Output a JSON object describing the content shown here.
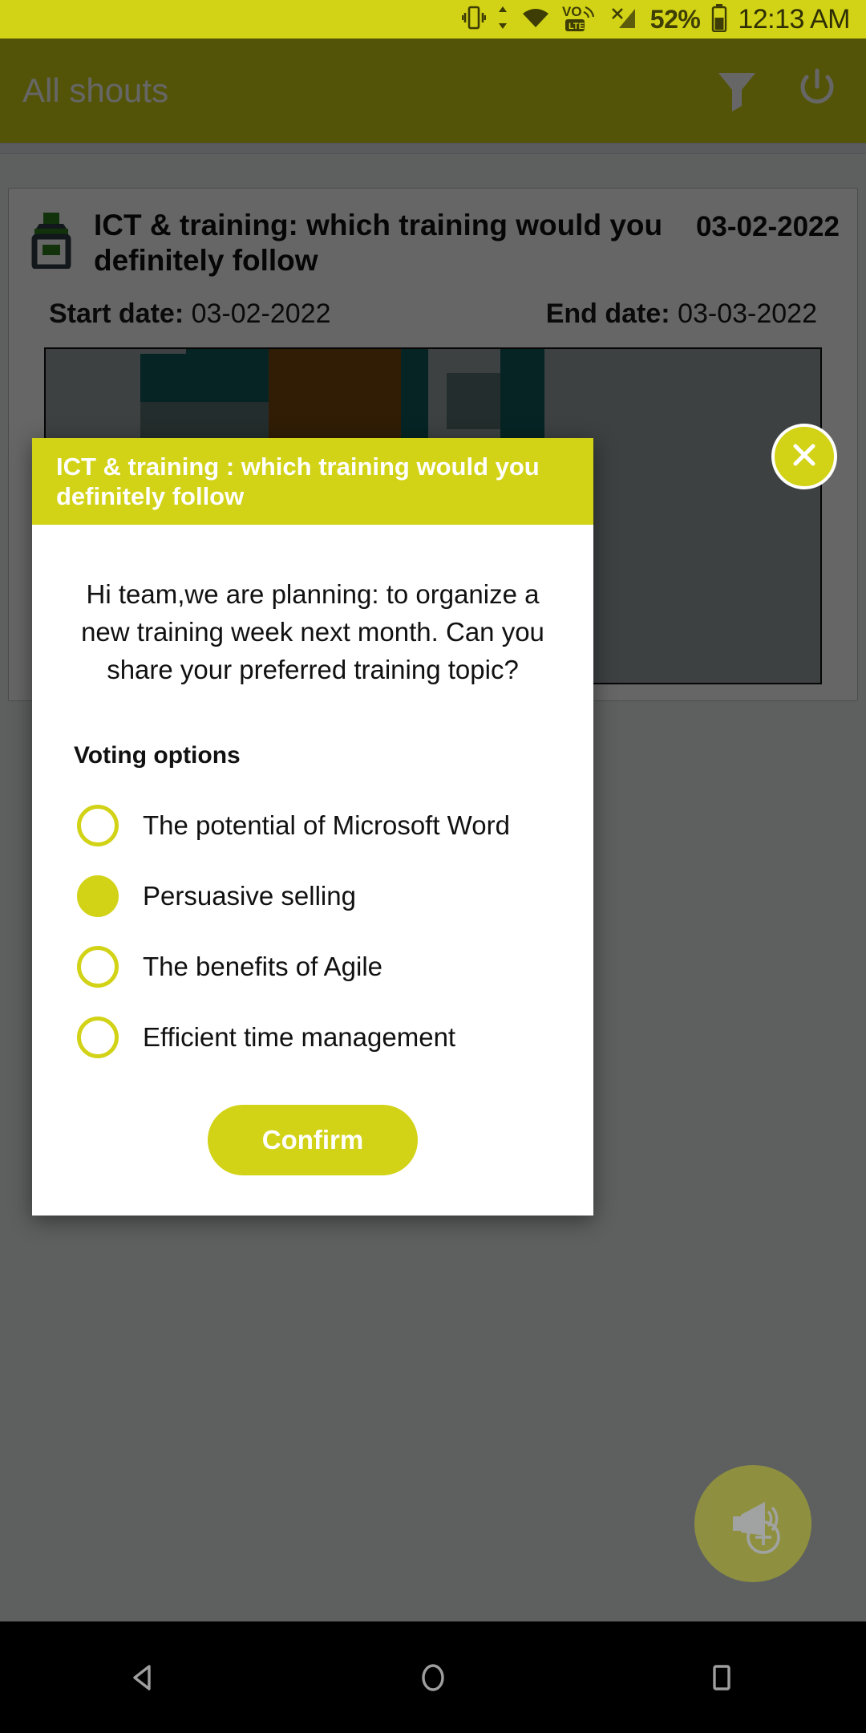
{
  "status_bar": {
    "battery_percent": "52%",
    "time": "12:13 AM",
    "icons": [
      "vibrate-icon",
      "data-transfer-icon",
      "wifi-icon",
      "volte-icon",
      "signal-off-icon",
      "battery-icon"
    ],
    "volte_label": "VO",
    "lte_label": "LTE",
    "background_color": "#d2d216"
  },
  "app_bar": {
    "title": "All shouts",
    "filter_icon": "filter-icon",
    "power_icon": "power-icon",
    "background_color": "#d2d216"
  },
  "shout_card": {
    "icon": "ballot-box-icon",
    "title": "ICT & training: which training would you definitely follow",
    "date": "03-02-2022",
    "start_date_label": "Start date:",
    "start_date": "03-02-2022",
    "end_date_label": "End date:",
    "end_date": "03-03-2022"
  },
  "fab": {
    "icon": "megaphone-add-icon",
    "background_color": "#d2d216"
  },
  "dialog": {
    "title": "ICT & training : which training would you definitely follow",
    "close_icon": "close-icon",
    "body_text": "Hi team,we are planning: to organize a new training week next month. Can you share your preferred training topic?",
    "voting_options_label": "Voting options",
    "options": [
      {
        "label": "The potential of Microsoft Word",
        "selected": false
      },
      {
        "label": "Persuasive selling",
        "selected": true
      },
      {
        "label": "The benefits of Agile",
        "selected": false
      },
      {
        "label": "Efficient time management",
        "selected": false
      }
    ],
    "confirm_label": "Confirm",
    "accent_color": "#d2d216"
  },
  "nav_bar": {
    "back_icon": "back-triangle-icon",
    "home_icon": "home-circle-icon",
    "recents_icon": "recents-square-icon"
  }
}
